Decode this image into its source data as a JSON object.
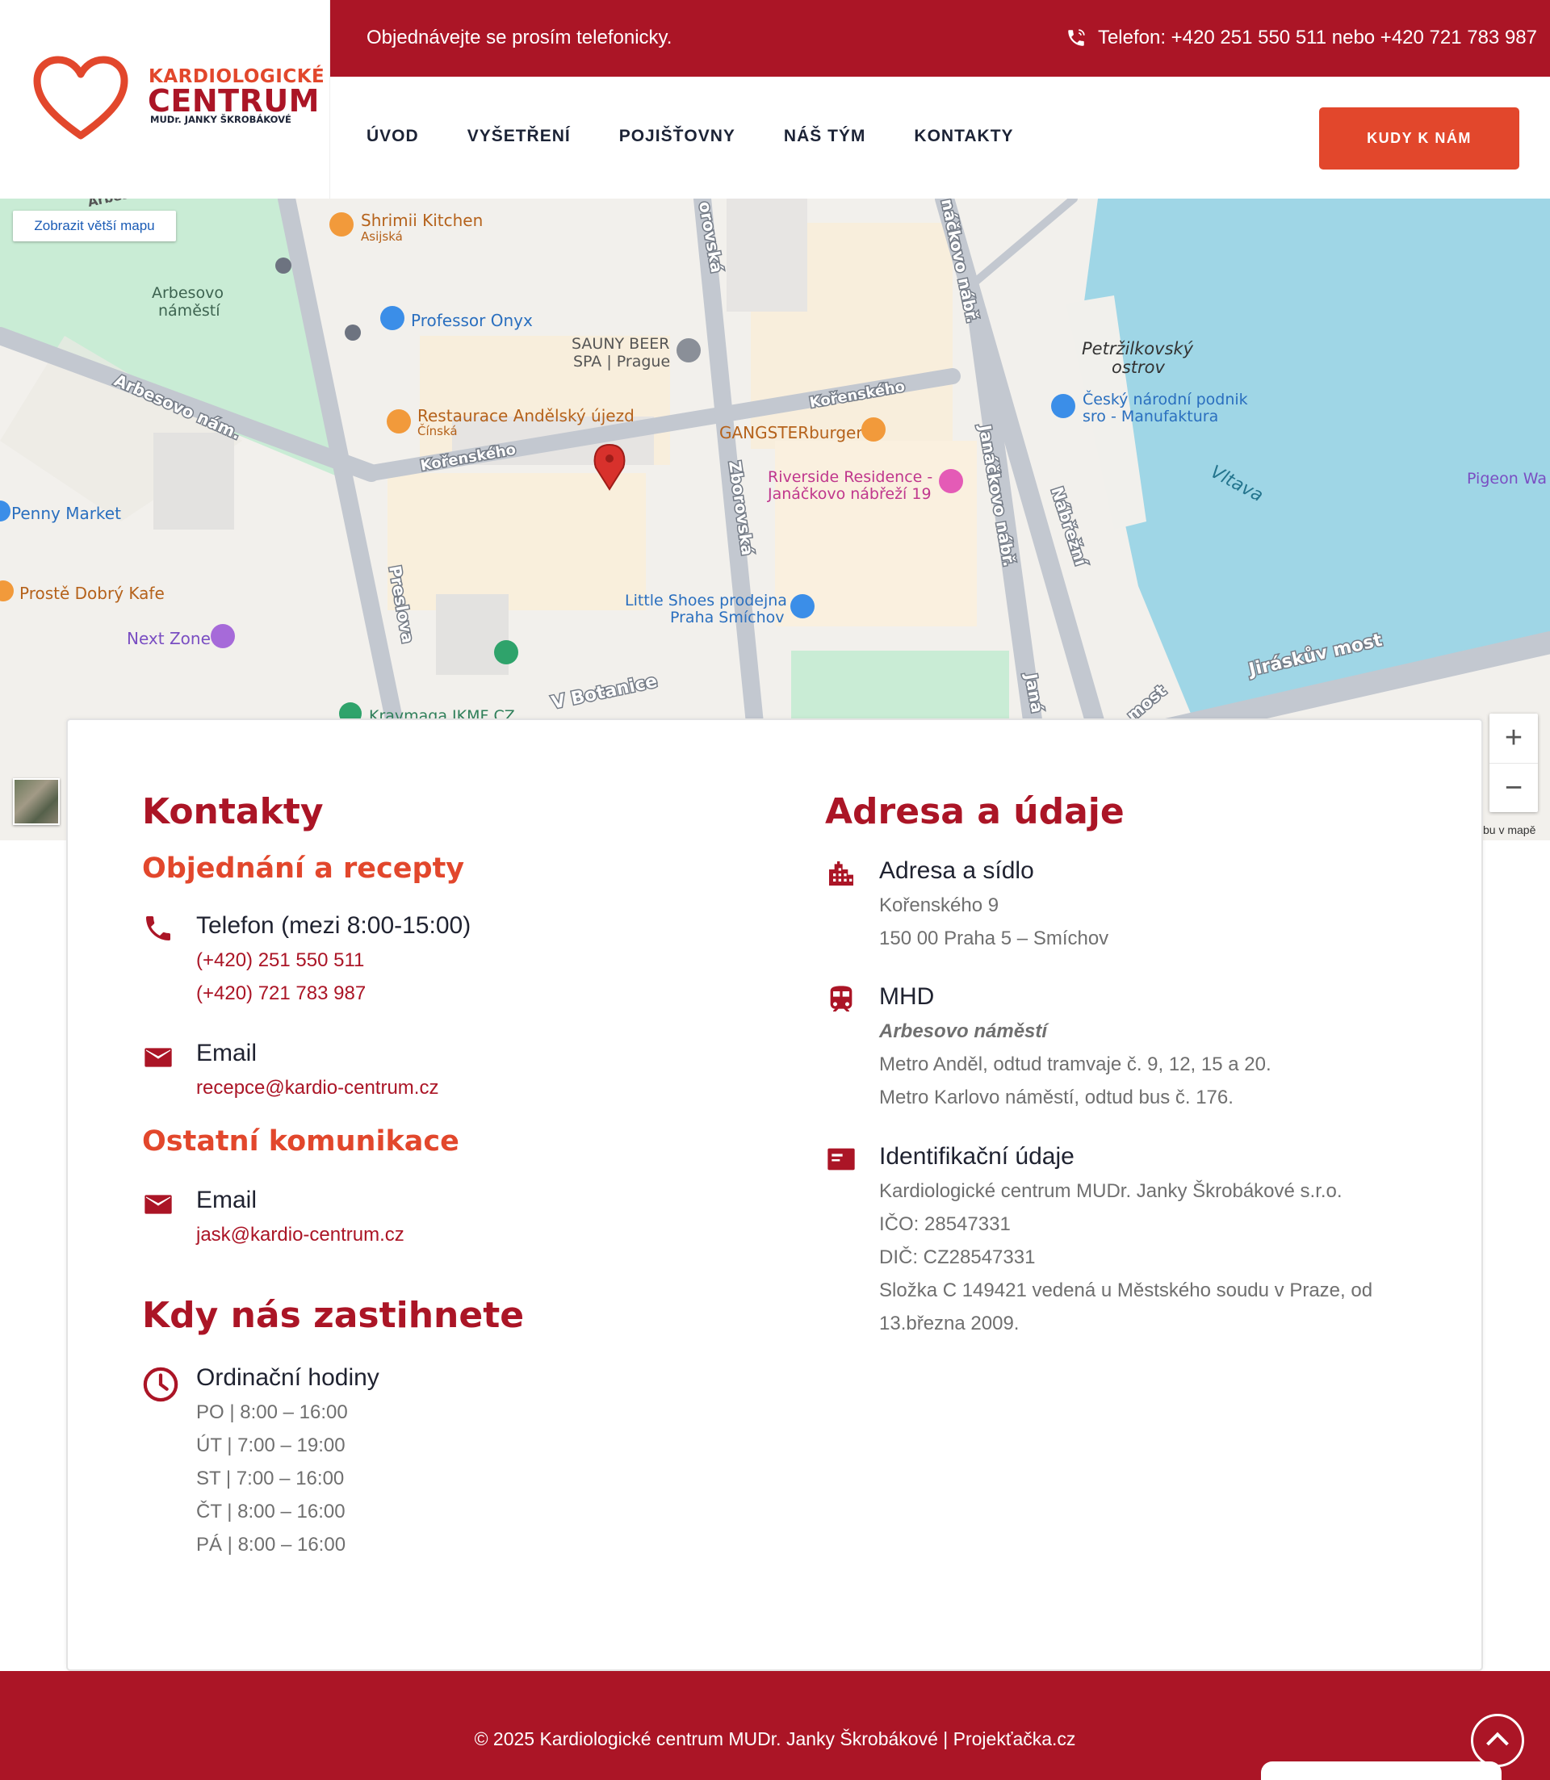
{
  "brand": {
    "name_line1": "KARDIOLOGICKÉ",
    "name_line2": "CENTRUM",
    "name_line3": "MUDr. JANKY ŠKROBÁKOVÉ",
    "primary_color": "#ab1526",
    "accent_color": "#e2472c"
  },
  "topbar": {
    "order_text": "Objednávejte se prosím telefonicky.",
    "phone_text": "Telefon: +420 251 550 511 nebo +420 721 783 987",
    "phone_icon": "phone-icon"
  },
  "nav": {
    "items": [
      "ÚVOD",
      "VYŠETŘENÍ",
      "POJIŠŤOVNY",
      "NÁŠ TÝM",
      "KONTAKTY"
    ],
    "cta_label": "KUDY K NÁM"
  },
  "map": {
    "larger_map_label": "Zobrazit větší mapu",
    "zoom_in": "+",
    "zoom_out": "−",
    "footer_text": "ybu v mapě",
    "labels": {
      "arbesovo_top": "Arbeso",
      "arbesovo_square": "Arbesovo",
      "arbesovo_square2": "náměstí",
      "arbesovo_nam": "Arbesovo nám.",
      "shrimii": "Shrimii Kitchen",
      "shrimii_sub": "Asijská",
      "professor": "Professor Onyx",
      "sauny1": "SAUNY BEER",
      "sauny2": "SPA | Prague",
      "restaurace": "Restaurace Andělský újezd",
      "restaurace_sub": "Čínská",
      "gangster": "GANGSTERburger",
      "korenskeho1": "Kořenského",
      "korenskeho2": "Kořenského",
      "zborovska_top": "orovská",
      "zborovska": "Zborovská",
      "janackovo_top": "náčkovo nábř.",
      "janackovo": "Janáčkovo nábř.",
      "nabrezni": "Nábřežní",
      "riverside1": "Riverside Residence -",
      "riverside2": "Janáčkovo nábřeží 19",
      "petrzilkovsky1": "Petržilkovský",
      "petrzilkovsky2": "ostrov",
      "cesky1": "Český národní podnik",
      "cesky2": "sro - Manufaktura",
      "vltava": "Vltava",
      "pigeon": "Pigeon Wa",
      "penny": "Penny Market",
      "proste": "Prostě Dobrý Kafe",
      "next_zone": "Next Zone",
      "preslova": "Preslova",
      "little1": "Little Shoes prodejna",
      "little2": "Praha Smíchov",
      "botanice": "V Botanice",
      "jiraskuv": "Jiráskův most",
      "most": "most",
      "jana_bottom": "Janá",
      "kravmaga": "Kravmaga IKMF CZ"
    }
  },
  "contacts": {
    "heading": "Kontakty",
    "order_heading": "Objednání a recepty",
    "phone": {
      "title": "Telefon (mezi 8:00-15:00)",
      "numbers": [
        "(+420) 251 550 511",
        "(+420) 721 783 987"
      ]
    },
    "email": {
      "title": "Email",
      "value": "recepce@kardio-centrum.cz"
    },
    "other_heading": "Ostatní komunikace",
    "other_email": {
      "title": "Email",
      "value": "jask@kardio-centrum.cz"
    },
    "hours_heading": "Kdy nás zastihnete",
    "hours": {
      "title": "Ordinační hodiny",
      "lines": [
        "PO | 8:00 – 16:00",
        "ÚT | 7:00 – 19:00",
        "ST | 7:00 – 16:00",
        "ČT | 8:00 – 16:00",
        "PÁ | 8:00 – 16:00"
      ]
    }
  },
  "address": {
    "heading": "Adresa a údaje",
    "seat": {
      "title": "Adresa a sídlo",
      "lines": [
        "Kořenského 9",
        "150 00 Praha 5 – Smíchov"
      ]
    },
    "transit": {
      "title": "MHD",
      "stop": "Arbesovo náměstí",
      "lines": [
        "Metro Anděl, odtud tramvaje č. 9, 12, 15 a 20.",
        "Metro Karlovo náměstí, odtud bus č. 176."
      ]
    },
    "ident": {
      "title": "Identifikační údaje",
      "lines": [
        "Kardiologické centrum MUDr. Janky Škrobákové s.r.o.",
        "IČO: 28547331",
        "DIČ: CZ28547331",
        "Složka C 149421 vedená u Městského soudu v Praze, od",
        "13.března 2009."
      ]
    }
  },
  "footer": {
    "copyright": "© 2025 Kardiologické centrum MUDr. Janky Škrobákové | Projekťačka.cz"
  }
}
